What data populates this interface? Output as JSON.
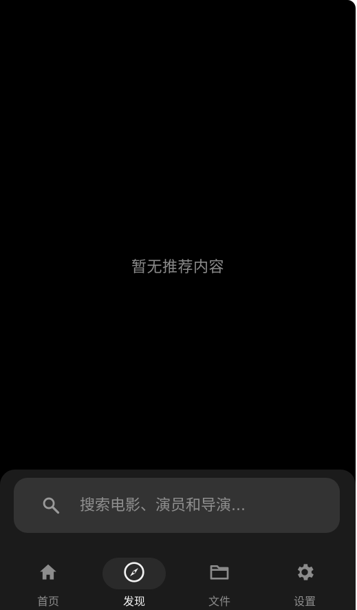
{
  "main": {
    "empty_message": "暂无推荐内容"
  },
  "search": {
    "placeholder": "搜索电影、演员和导演..."
  },
  "tabs": [
    {
      "label": "首页",
      "icon": "home-icon",
      "active": false
    },
    {
      "label": "发现",
      "icon": "compass-icon",
      "active": true
    },
    {
      "label": "文件",
      "icon": "folder-icon",
      "active": false
    },
    {
      "label": "设置",
      "icon": "gear-icon",
      "active": false
    }
  ],
  "colors": {
    "background": "#000000",
    "panel": "#1b1b1b",
    "search_bg": "#333333",
    "active_pill": "#2a2a2a",
    "muted_text": "#8c8c8c",
    "active_text": "#f2f2f2"
  }
}
